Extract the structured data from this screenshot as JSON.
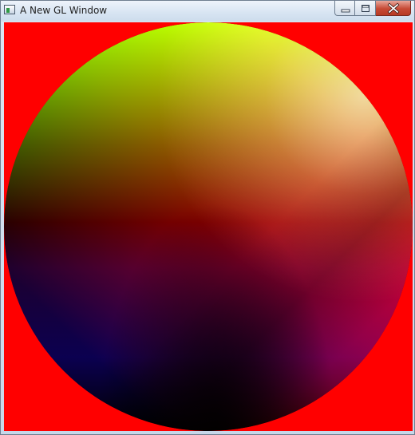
{
  "window": {
    "title": "A New GL Window",
    "app_icon": "app-window-icon",
    "buttons": {
      "minimize": "minimize-icon",
      "maximize": "maximize-icon",
      "close": "close-icon"
    }
  },
  "scene": {
    "background_color": "#ff0000",
    "sphere_colors": {
      "top": "#00ff00",
      "middle": "#150000",
      "bottom_left": "#000050",
      "right": "#ff0000",
      "highlight": "#d2d2d2"
    }
  }
}
